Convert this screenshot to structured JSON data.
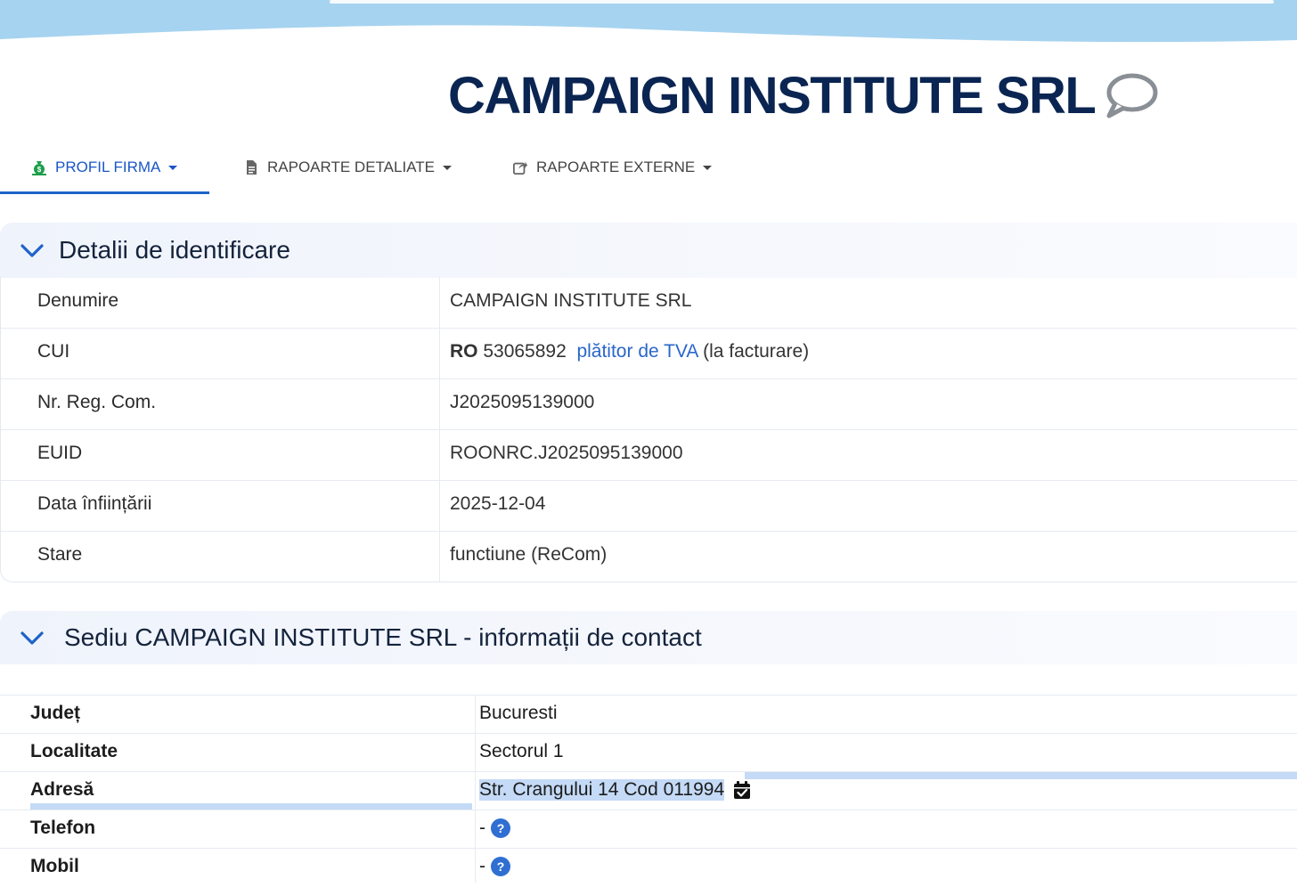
{
  "header": {
    "company_title": "CAMPAIGN INSTITUTE SRL"
  },
  "nav": {
    "tabs": [
      {
        "label": "PROFIL FIRMA",
        "icon": "money-bag-icon",
        "active": true
      },
      {
        "label": "RAPOARTE DETALIATE",
        "icon": "document-icon",
        "active": false
      },
      {
        "label": "RAPOARTE EXTERNE",
        "icon": "share-icon",
        "active": false
      }
    ]
  },
  "identification": {
    "title": "Detalii de identificare",
    "rows": [
      {
        "label": "Denumire",
        "value": "CAMPAIGN INSTITUTE SRL"
      },
      {
        "label": "CUI",
        "prefix": "RO",
        "value": "53065892",
        "vat_link": "plătitor de TVA",
        "vat_note": "(la facturare)"
      },
      {
        "label": "Nr. Reg. Com.",
        "value": "J2025095139000"
      },
      {
        "label": "EUID",
        "value": "ROONRC.J2025095139000"
      },
      {
        "label": "Data înființării",
        "value": "2025-12-04"
      },
      {
        "label": "Stare",
        "value": "functiune (ReCom)"
      }
    ]
  },
  "contact": {
    "title": "Sediu CAMPAIGN INSTITUTE SRL - informații de contact",
    "rows": [
      {
        "label": "Județ",
        "value": "Bucuresti"
      },
      {
        "label": "Localitate",
        "value": "Sectorul 1"
      },
      {
        "label": "Adresă",
        "value": "Str. Crangului 14 Cod 011994"
      },
      {
        "label": "Telefon",
        "value": "-",
        "help": "?"
      },
      {
        "label": "Mobil",
        "value": "-",
        "help": "?"
      }
    ]
  },
  "colors": {
    "title": "#0b2552",
    "accent": "#1e63c9",
    "wave": "#a6d3f0",
    "selection": "#c4daf6"
  }
}
